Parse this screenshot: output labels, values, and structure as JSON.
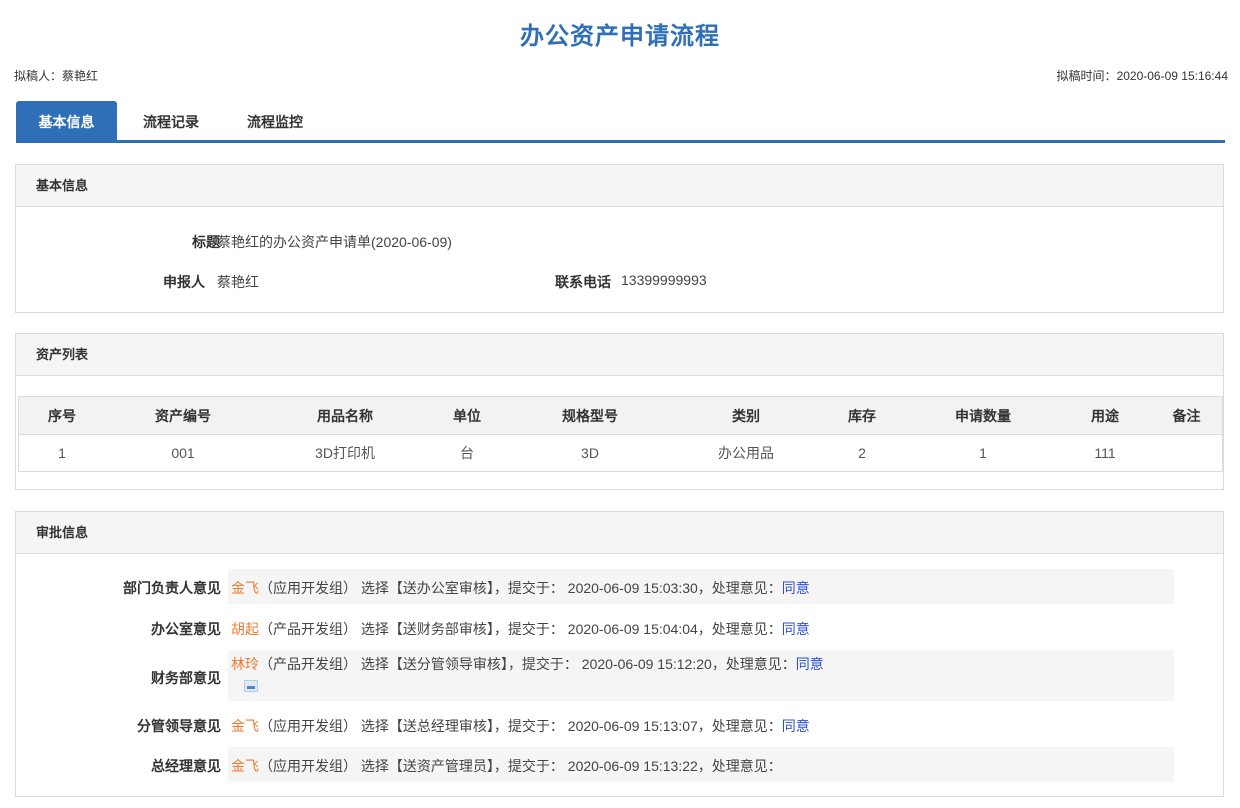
{
  "page": {
    "title": "办公资产申请流程",
    "drafter_label": "拟稿人：",
    "drafter": "蔡艳红",
    "draft_time_label": "拟稿时间：",
    "draft_time": "2020-06-09 15:16:44"
  },
  "tabs": [
    {
      "label": "基本信息",
      "active": true
    },
    {
      "label": "流程记录",
      "active": false
    },
    {
      "label": "流程监控",
      "active": false
    }
  ],
  "basic": {
    "heading": "基本信息",
    "title_label": "标题",
    "title_value": "蔡艳红的办公资产申请单(2020-06-09)",
    "applicant_label": "申报人",
    "applicant_value": "蔡艳红",
    "phone_label": "联系电话",
    "phone_value": "13399999993"
  },
  "assets": {
    "heading": "资产列表",
    "columns": [
      "序号",
      "资产编号",
      "用品名称",
      "单位",
      "规格型号",
      "类别",
      "库存",
      "申请数量",
      "用途",
      "备注"
    ],
    "rows": [
      [
        "1",
        "001",
        "3D打印机",
        "台",
        "3D",
        "办公用品",
        "2",
        "1",
        "111",
        ""
      ]
    ]
  },
  "approval": {
    "heading": "审批信息",
    "items": [
      {
        "label": "部门负责人意见",
        "name": "金飞",
        "dept": "（应用开发组）",
        "action": "选择【送办公室审核】，提交于：",
        "time": "2020-06-09 15:03:30，处理意见：",
        "opinion": "同意"
      },
      {
        "label": "办公室意见",
        "name": "胡起",
        "dept": "（产品开发组）",
        "action": "选择【送财务部审核】，提交于：",
        "time": "2020-06-09 15:04:04，处理意见：",
        "opinion": "同意"
      },
      {
        "label": "财务部意见",
        "name": "林玲",
        "dept": "（产品开发组）",
        "action": "选择【送分管领导审核】，提交于：",
        "time": "2020-06-09 15:12:20，处理意见：",
        "opinion": "同意",
        "attachment_icon": "image-icon"
      },
      {
        "label": "分管领导意见",
        "name": "金飞",
        "dept": "（应用开发组）",
        "action": "选择【送总经理审核】，提交于：",
        "time": "2020-06-09 15:13:07，处理意见：",
        "opinion": "同意"
      },
      {
        "label": "总经理意见",
        "name": "金飞",
        "dept": "（应用开发组）",
        "action": "选择【送资产管理员】，提交于：",
        "time": "2020-06-09 15:13:22，处理意见：",
        "opinion": ""
      }
    ]
  },
  "colors": {
    "accent": "#2e6fb7",
    "name": "#f07b2f",
    "opinion": "#2d4fd8"
  }
}
